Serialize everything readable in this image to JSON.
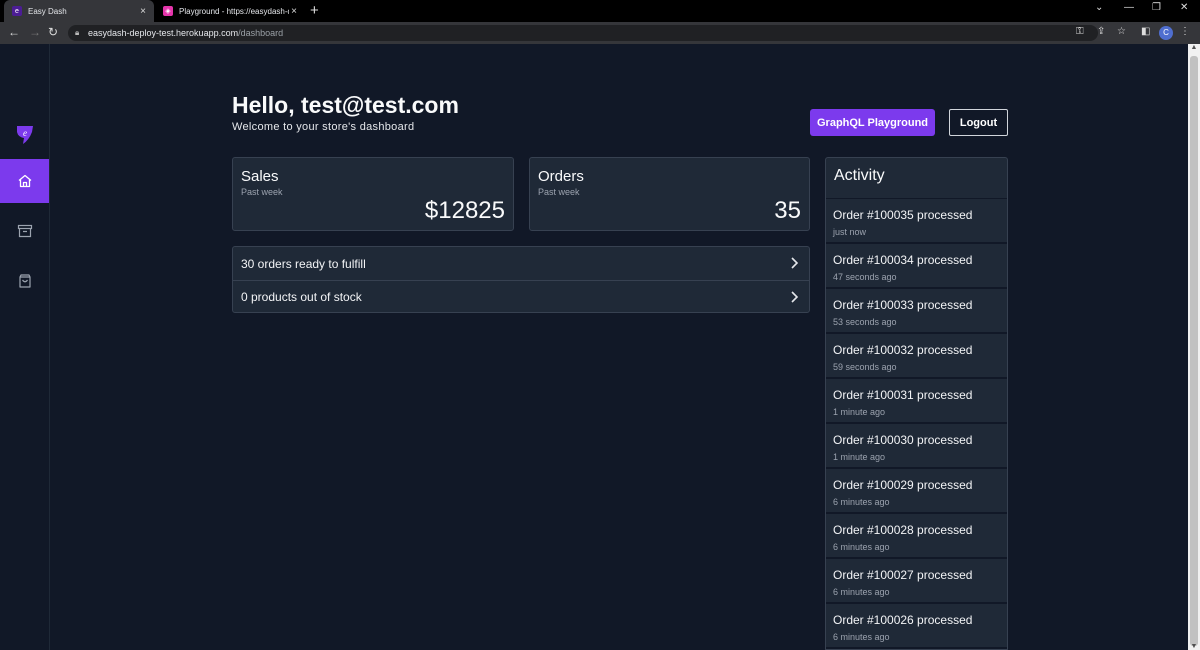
{
  "browser": {
    "tabs": [
      {
        "title": "Easy Dash",
        "close": "×"
      },
      {
        "title": "Playground - https://easydash-d",
        "close": "×"
      }
    ],
    "new_tab": "+",
    "url_host": "easydash-deploy-test.herokuapp.com",
    "url_path": "/dashboard",
    "profile_initial": "C"
  },
  "header": {
    "greeting": "Hello, test@test.com",
    "subtitle": "Welcome to your store's dashboard",
    "graphql_button": "GraphQL Playground",
    "logout_button": "Logout"
  },
  "sidebar": {
    "items": [
      {
        "name": "home",
        "icon": "home-icon",
        "active": true
      },
      {
        "name": "archive",
        "icon": "archive-icon",
        "active": false
      },
      {
        "name": "shopping-bag",
        "icon": "shopping-bag-icon",
        "active": false
      }
    ]
  },
  "stats": {
    "sales": {
      "title": "Sales",
      "period": "Past week",
      "value": "$12825"
    },
    "orders": {
      "title": "Orders",
      "period": "Past week",
      "value": "35"
    }
  },
  "tasks": [
    {
      "label": "30 orders ready to fulfill"
    },
    {
      "label": "0 products out of stock"
    }
  ],
  "activity": {
    "title": "Activity",
    "items": [
      {
        "text": "Order #100035 processed",
        "time": "just now"
      },
      {
        "text": "Order #100034 processed",
        "time": "47 seconds ago"
      },
      {
        "text": "Order #100033 processed",
        "time": "53 seconds ago"
      },
      {
        "text": "Order #100032 processed",
        "time": "59 seconds ago"
      },
      {
        "text": "Order #100031 processed",
        "time": "1 minute ago"
      },
      {
        "text": "Order #100030 processed",
        "time": "1 minute ago"
      },
      {
        "text": "Order #100029 processed",
        "time": "6 minutes ago"
      },
      {
        "text": "Order #100028 processed",
        "time": "6 minutes ago"
      },
      {
        "text": "Order #100027 processed",
        "time": "6 minutes ago"
      },
      {
        "text": "Order #100026 processed",
        "time": "6 minutes ago"
      }
    ]
  },
  "colors": {
    "accent": "#7c3aed",
    "background": "#111827",
    "card": "#1f2937"
  }
}
